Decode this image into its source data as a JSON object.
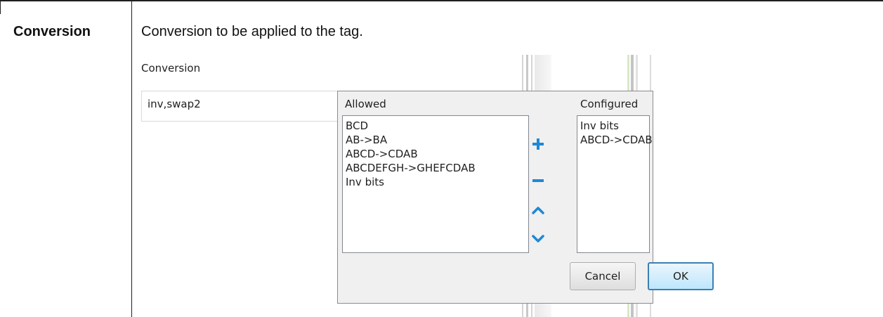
{
  "doc": {
    "term": "Conversion",
    "description": "Conversion to be applied to the tag."
  },
  "field": {
    "label": "Conversion",
    "value": "inv,swap2"
  },
  "popup": {
    "allowed_title": "Allowed",
    "configured_title": "Configured",
    "allowed_items": [
      "BCD",
      "AB->BA",
      "ABCD->CDAB",
      "ABCDEFGH->GHEFCDAB",
      "Inv bits"
    ],
    "configured_items": [
      "Inv bits",
      "ABCD->CDAB"
    ],
    "cancel_label": "Cancel",
    "ok_label": "OK",
    "icons": {
      "add": "plus-icon",
      "remove": "minus-icon",
      "up": "chevron-up-icon",
      "down": "chevron-down-icon"
    },
    "accent_color": "#1e88d6"
  }
}
